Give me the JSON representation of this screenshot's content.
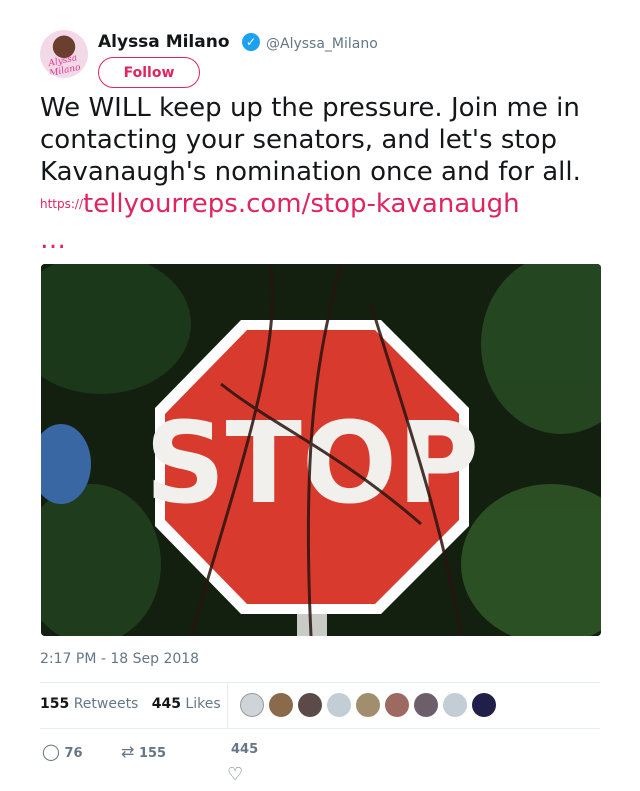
{
  "account": {
    "name": "Alyssa Milano",
    "handle": "@Alyssa_Milano",
    "avatar_text": "Alyssa Milano",
    "follow_label": "Follow"
  },
  "tweet": {
    "text": "We WILL keep up the pressure. Join me in contacting your senators, and let's stop Kavanaugh's nomination once and for all. ",
    "link_prefix": "https://",
    "link_text": "tellyourreps.com/stop-kavanaugh",
    "ellipsis": "…",
    "image_sign_text": "STOP"
  },
  "timestamp": "2:17 PM - 18 Sep 2018",
  "stats": {
    "retweets_count": "155",
    "retweets_label": "Retweets",
    "likes_count": "445",
    "likes_label": "Likes"
  },
  "actions": {
    "reply_count": "76",
    "retweet_count": "155",
    "like_count": "445"
  },
  "colors": {
    "accent": "#e0245e",
    "verified": "#1da1f2",
    "muted": "#657786",
    "text": "#14171a"
  },
  "icons": [
    "verified-badge-icon",
    "reply-icon",
    "retweet-icon",
    "heart-icon"
  ]
}
